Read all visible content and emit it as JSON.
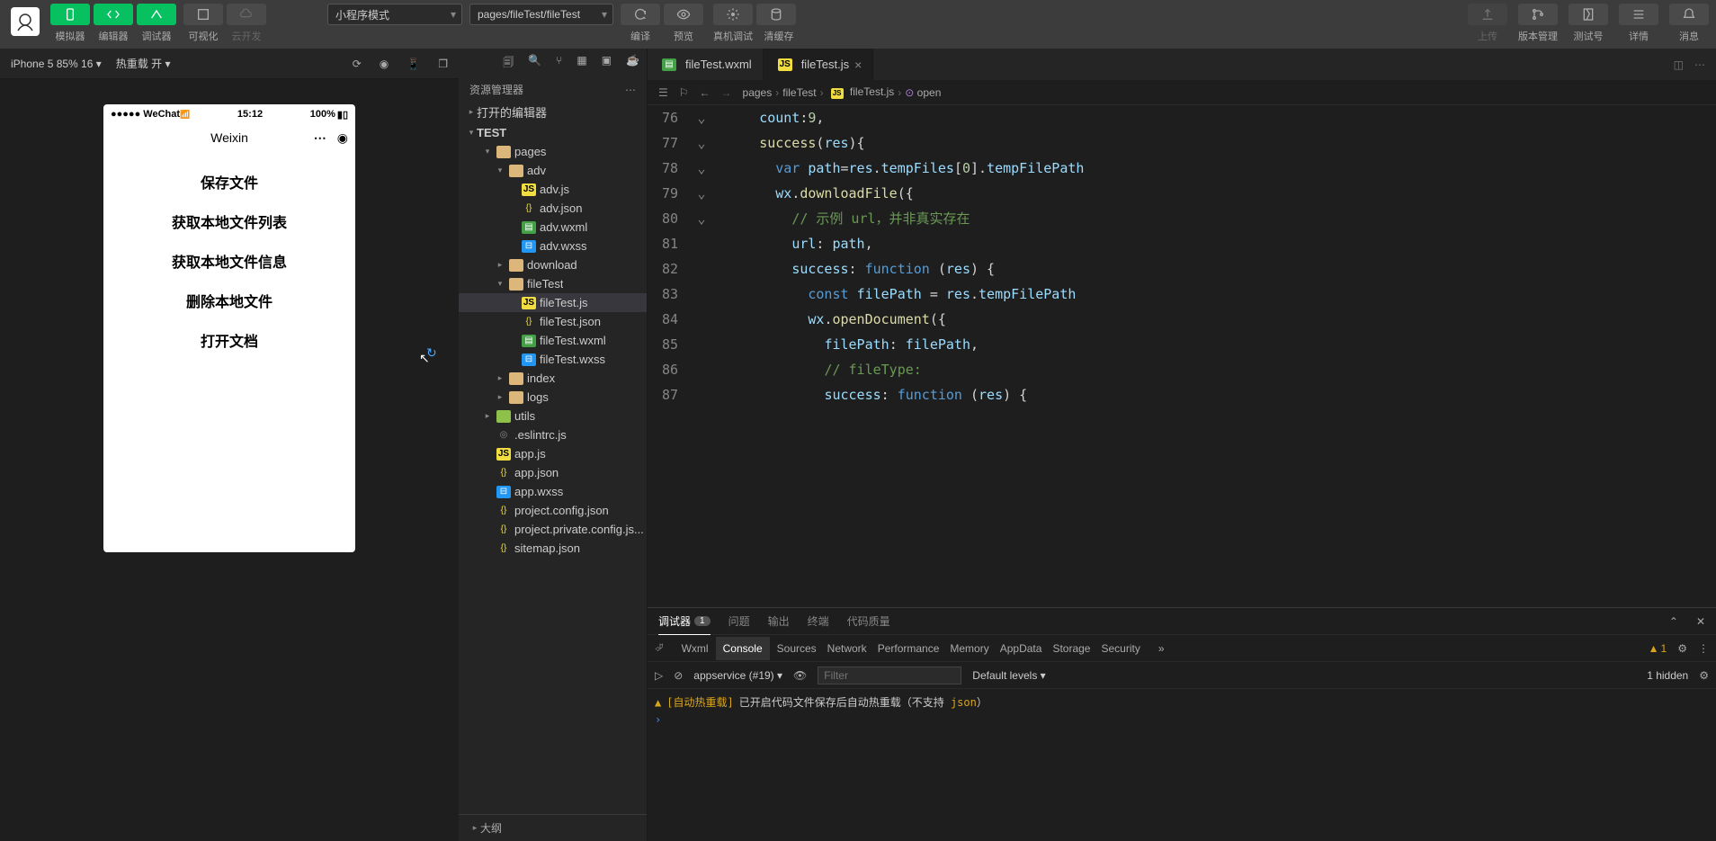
{
  "toolbar": {
    "mode_dropdown": "小程序模式",
    "page_dropdown": "pages/fileTest/fileTest",
    "labels": {
      "simulator": "模拟器",
      "editor": "编辑器",
      "debugger": "调试器",
      "visualize": "可视化",
      "cloud": "云开发",
      "compile": "编译",
      "preview": "预览",
      "remote_debug": "真机调试",
      "clear_cache": "清缓存",
      "upload": "上传",
      "version": "版本管理",
      "test_id": "测试号",
      "details": "详情",
      "messages": "消息"
    }
  },
  "simbar": {
    "device": "iPhone 5 85% 16",
    "hot_reload": "热重载 开"
  },
  "phone": {
    "carrier": "●●●●● WeChat",
    "time": "15:12",
    "battery": "100%",
    "title": "Weixin",
    "buttons": [
      "保存文件",
      "获取本地文件列表",
      "获取本地文件信息",
      "删除本地文件",
      "打开文档"
    ]
  },
  "explorer": {
    "title": "资源管理器",
    "open_editors": "打开的编辑器",
    "root": "TEST",
    "outline": "大纲",
    "tree": [
      {
        "name": "pages",
        "type": "folder-open",
        "depth": 1,
        "expanded": true
      },
      {
        "name": "adv",
        "type": "folder-open",
        "depth": 2,
        "expanded": true
      },
      {
        "name": "adv.js",
        "type": "js",
        "depth": 3
      },
      {
        "name": "adv.json",
        "type": "json",
        "depth": 3
      },
      {
        "name": "adv.wxml",
        "type": "wxml",
        "depth": 3
      },
      {
        "name": "adv.wxss",
        "type": "wxss",
        "depth": 3
      },
      {
        "name": "download",
        "type": "folder",
        "depth": 2
      },
      {
        "name": "fileTest",
        "type": "folder-open",
        "depth": 2,
        "expanded": true
      },
      {
        "name": "fileTest.js",
        "type": "js",
        "depth": 3,
        "selected": true
      },
      {
        "name": "fileTest.json",
        "type": "json",
        "depth": 3
      },
      {
        "name": "fileTest.wxml",
        "type": "wxml",
        "depth": 3
      },
      {
        "name": "fileTest.wxss",
        "type": "wxss",
        "depth": 3
      },
      {
        "name": "index",
        "type": "folder",
        "depth": 2
      },
      {
        "name": "logs",
        "type": "folder",
        "depth": 2
      },
      {
        "name": "utils",
        "type": "folder-green",
        "depth": 1
      },
      {
        "name": ".eslintrc.js",
        "type": "config",
        "depth": 1
      },
      {
        "name": "app.js",
        "type": "js",
        "depth": 1
      },
      {
        "name": "app.json",
        "type": "json",
        "depth": 1
      },
      {
        "name": "app.wxss",
        "type": "wxss",
        "depth": 1
      },
      {
        "name": "project.config.json",
        "type": "json",
        "depth": 1
      },
      {
        "name": "project.private.config.js...",
        "type": "json",
        "depth": 1
      },
      {
        "name": "sitemap.json",
        "type": "json",
        "depth": 1
      }
    ]
  },
  "editor": {
    "tabs": [
      {
        "name": "fileTest.wxml",
        "icon": "wxml",
        "active": false
      },
      {
        "name": "fileTest.js",
        "icon": "js",
        "active": true
      }
    ],
    "breadcrumb": [
      "pages",
      "fileTest",
      "fileTest.js",
      "open"
    ],
    "line_numbers": [
      "76",
      "77",
      "78",
      "79",
      "80",
      "81",
      "82",
      "83",
      "84",
      "85",
      "86",
      "87"
    ]
  },
  "debug": {
    "tabs": {
      "debugger": "调试器",
      "problems": "问题",
      "output": "输出",
      "terminal": "终端",
      "quality": "代码质量"
    },
    "debugger_count": "1",
    "devtools": [
      "Wxml",
      "Console",
      "Sources",
      "Network",
      "Performance",
      "Memory",
      "AppData",
      "Storage",
      "Security"
    ],
    "devtools_active": "Console",
    "warn_count": "1",
    "context": "appservice (#19)",
    "filter_placeholder": "Filter",
    "levels": "Default levels",
    "hidden": "1 hidden",
    "log": {
      "tag": "[自动热重载]",
      "msg": "已开启代码文件保存后自动热重载（不支持",
      "json": "json",
      "suffix": "）"
    }
  }
}
